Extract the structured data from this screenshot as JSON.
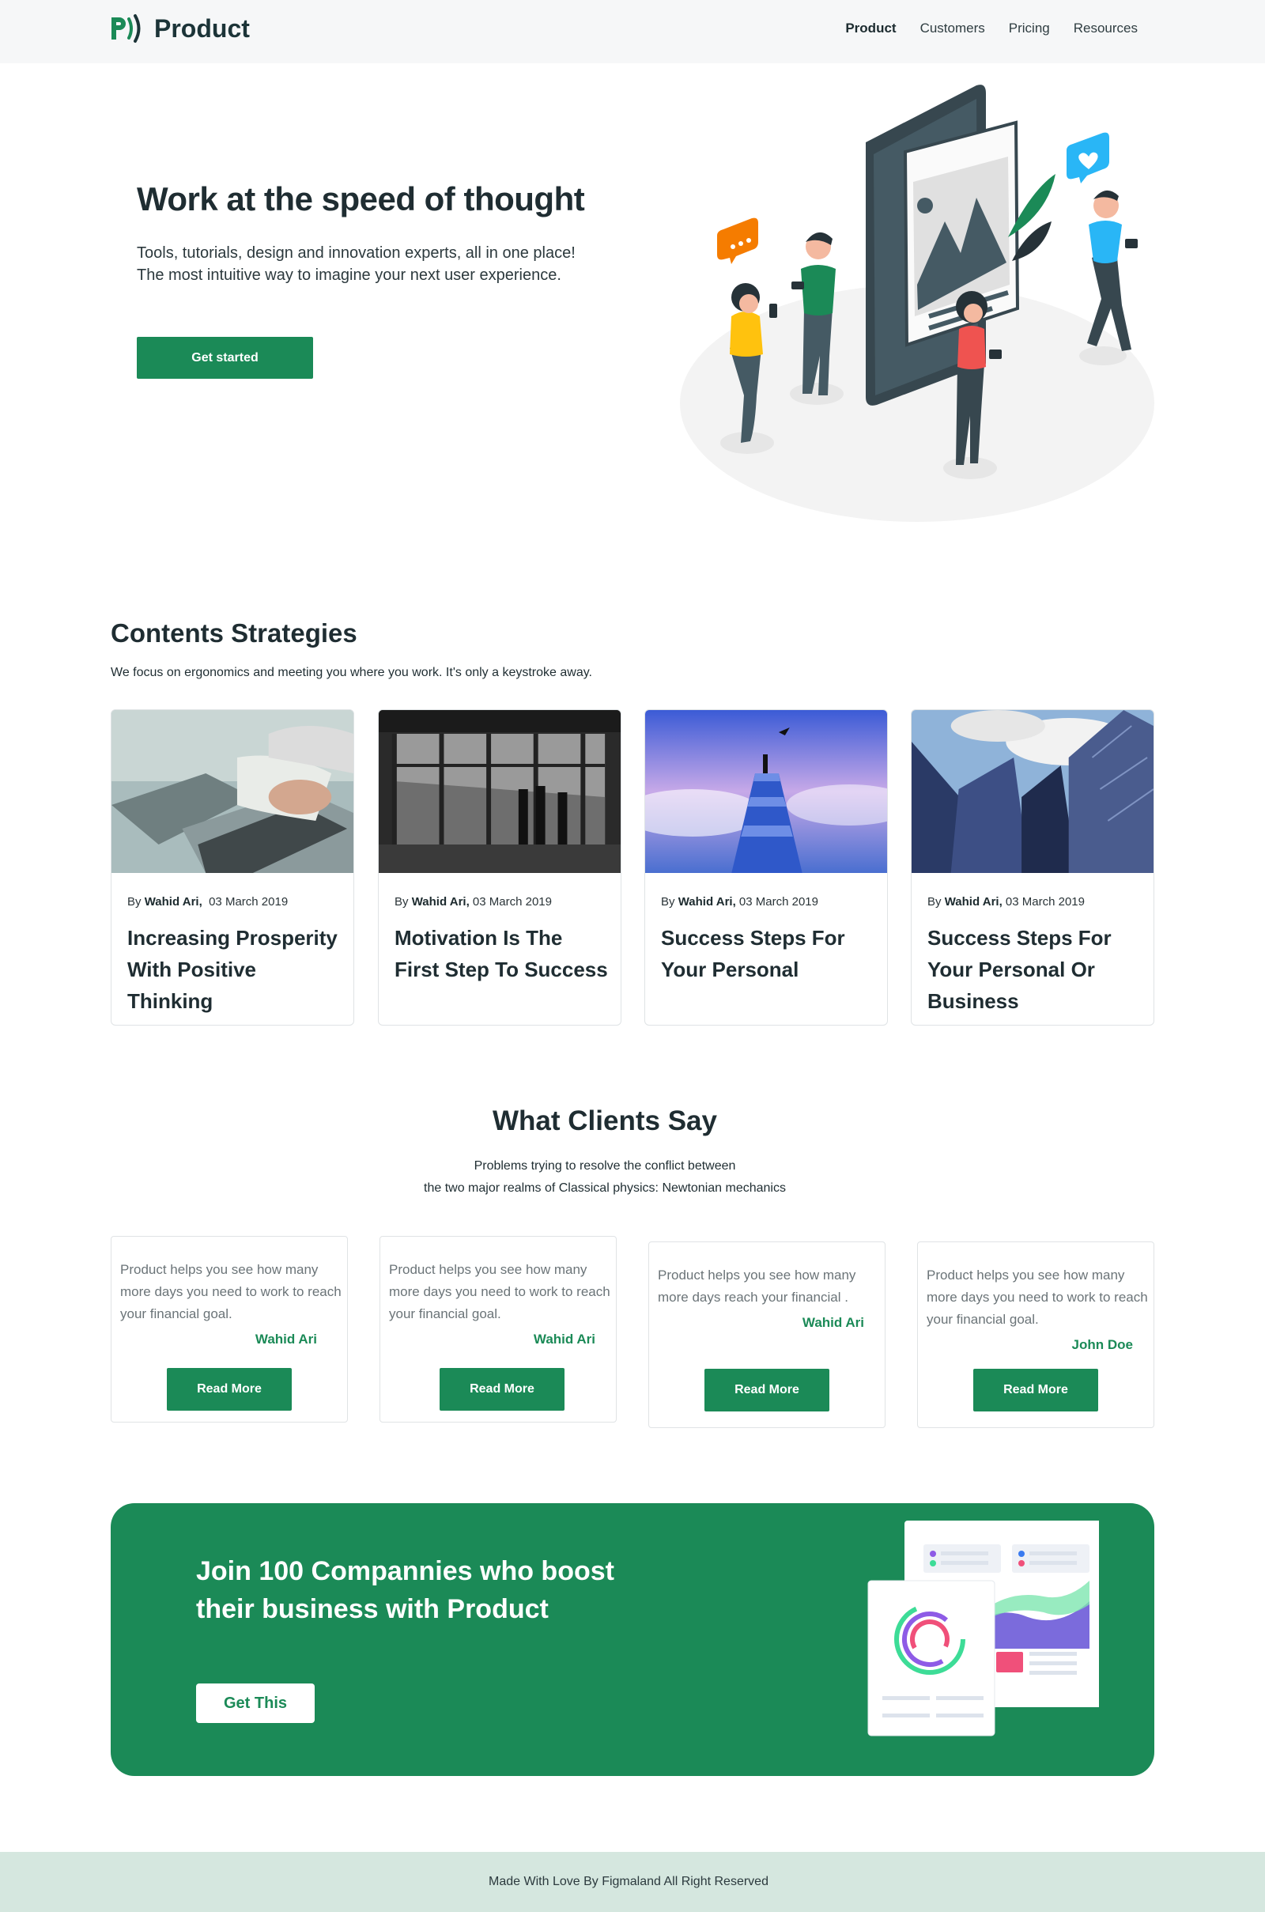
{
  "nav": {
    "brand": "Product",
    "links": [
      "Product",
      "Customers",
      "Pricing",
      "Resources"
    ]
  },
  "hero": {
    "title": "Work at the speed  of thought",
    "subtitle": "Tools, tutorials, design and innovation experts, all in one place! The most intuitive way to imagine your next user experience.",
    "cta": "Get started"
  },
  "strategies": {
    "title": "Contents Strategies",
    "subtitle": "We focus on ergonomics and meeting you where you work. It's only a keystroke away.",
    "cards": [
      {
        "by": "By",
        "author": "Wahid Ari,",
        "date": "03 March 2019",
        "title": "Increasing Prosperity With Positive Thinking"
      },
      {
        "by": "By",
        "author": "Wahid Ari,",
        "date": "03 March 2019",
        "title": "Motivation Is The First Step To Success"
      },
      {
        "by": "By",
        "author": "Wahid Ari,",
        "date": "03 March 2019",
        "title": "Success Steps For Your Personal"
      },
      {
        "by": "By",
        "author": "Wahid Ari,",
        "date": "03 March 2019",
        "title": "Success Steps For Your Personal Or Business"
      }
    ]
  },
  "clients": {
    "title": "What Clients Say",
    "subtitle_line1": "Problems trying to resolve the conflict between",
    "subtitle_line2": "the two major realms of Classical physics: Newtonian mechanics",
    "testimonials": [
      {
        "text": "Product helps you see how many more days you need to work to reach your financial goal.",
        "name": "Wahid Ari",
        "button": "Read More"
      },
      {
        "text": "Product helps you see how many more days you need to work to reach your financial goal.",
        "name": "Wahid Ari",
        "button": "Read More"
      },
      {
        "text": "Product helps you see how many more days  reach your financial .",
        "name": "Wahid Ari",
        "button": "Read More"
      },
      {
        "text": "Product helps you see how many more days you need to work to reach your financial goal.",
        "name": "John Doe",
        "button": "Read More"
      }
    ]
  },
  "cta": {
    "title": "Join 100 Compannies who boost their business with Product",
    "button": "Get This"
  },
  "footer": {
    "text": "Made With Love By Figmaland All Right Reserved"
  },
  "colors": {
    "brand_green": "#1b8a57",
    "footer_bg": "#d5e7df",
    "nav_bg": "#f6f7f8"
  }
}
